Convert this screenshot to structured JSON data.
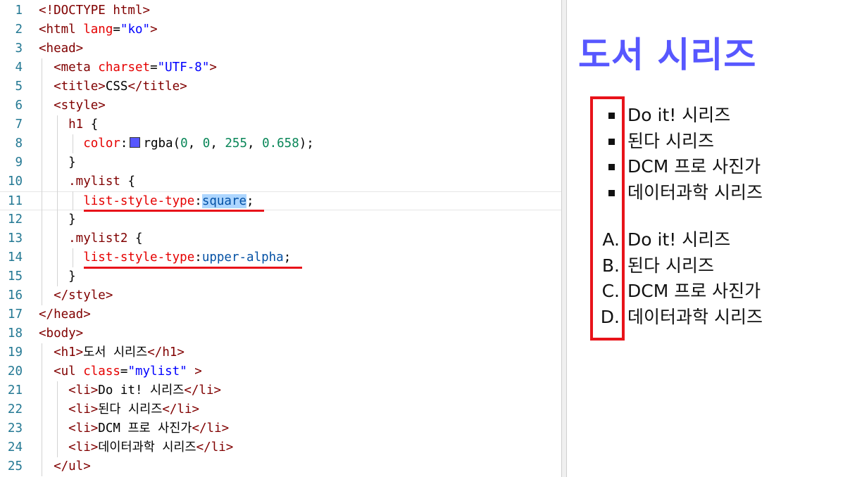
{
  "editor": {
    "lines": [
      {
        "n": "1",
        "parts": [
          {
            "t": "<!DOCTYPE html>",
            "c": "tag"
          }
        ]
      },
      {
        "n": "2",
        "parts": [
          {
            "t": "<html ",
            "c": "tag"
          },
          {
            "t": "lang",
            "c": "attr"
          },
          {
            "t": "=",
            "c": "txt"
          },
          {
            "t": "\"ko\"",
            "c": "val"
          },
          {
            "t": ">",
            "c": "tag"
          }
        ]
      },
      {
        "n": "3",
        "parts": [
          {
            "t": "<head>",
            "c": "tag"
          }
        ]
      },
      {
        "n": "4",
        "parts": [
          {
            "t": "  <meta ",
            "c": "tag"
          },
          {
            "t": "charset",
            "c": "attr"
          },
          {
            "t": "=",
            "c": "txt"
          },
          {
            "t": "\"UTF-8\"",
            "c": "val"
          },
          {
            "t": ">",
            "c": "tag"
          }
        ]
      },
      {
        "n": "5",
        "parts": [
          {
            "t": "  <title>",
            "c": "tag"
          },
          {
            "t": "CSS",
            "c": "txt"
          },
          {
            "t": "</title>",
            "c": "tag"
          }
        ]
      },
      {
        "n": "6",
        "parts": [
          {
            "t": "  <style>",
            "c": "tag"
          }
        ]
      },
      {
        "n": "7",
        "parts": [
          {
            "t": "    h1 ",
            "c": "sel"
          },
          {
            "t": "{",
            "c": "txt"
          }
        ]
      },
      {
        "n": "8",
        "parts": [
          {
            "t": "      color",
            "c": "prop"
          },
          {
            "t": ":",
            "c": "txt"
          },
          {
            "t": "",
            "c": "swatch"
          },
          {
            "t": "rgba(",
            "c": "txt"
          },
          {
            "t": "0",
            "c": "num"
          },
          {
            "t": ", ",
            "c": "txt"
          },
          {
            "t": "0",
            "c": "num"
          },
          {
            "t": ", ",
            "c": "txt"
          },
          {
            "t": "255",
            "c": "num"
          },
          {
            "t": ", ",
            "c": "txt"
          },
          {
            "t": "0.658",
            "c": "num"
          },
          {
            "t": ");",
            "c": "txt"
          }
        ]
      },
      {
        "n": "9",
        "parts": [
          {
            "t": "    }",
            "c": "txt"
          }
        ]
      },
      {
        "n": "10",
        "parts": [
          {
            "t": "    .mylist ",
            "c": "sel"
          },
          {
            "t": "{",
            "c": "txt"
          }
        ]
      },
      {
        "n": "11",
        "current": true,
        "parts": [
          {
            "t": "      list-style-type",
            "c": "prop"
          },
          {
            "t": ":",
            "c": "txt"
          },
          {
            "t": "square",
            "c": "pval hl"
          },
          {
            "t": ";",
            "c": "txt"
          }
        ]
      },
      {
        "n": "12",
        "parts": [
          {
            "t": "    }",
            "c": "txt"
          }
        ]
      },
      {
        "n": "13",
        "parts": [
          {
            "t": "    .mylist2 ",
            "c": "sel"
          },
          {
            "t": "{",
            "c": "txt"
          }
        ]
      },
      {
        "n": "14",
        "parts": [
          {
            "t": "      list-style-type",
            "c": "prop"
          },
          {
            "t": ":",
            "c": "txt"
          },
          {
            "t": "upper-alpha",
            "c": "pval"
          },
          {
            "t": ";",
            "c": "txt"
          }
        ]
      },
      {
        "n": "15",
        "parts": [
          {
            "t": "    }",
            "c": "txt"
          }
        ]
      },
      {
        "n": "16",
        "parts": [
          {
            "t": "  </style>",
            "c": "tag"
          }
        ]
      },
      {
        "n": "17",
        "parts": [
          {
            "t": "</head>",
            "c": "tag"
          }
        ]
      },
      {
        "n": "18",
        "parts": [
          {
            "t": "<body>",
            "c": "tag"
          }
        ]
      },
      {
        "n": "19",
        "parts": [
          {
            "t": "  <h1>",
            "c": "tag"
          },
          {
            "t": "도서 시리즈",
            "c": "txt"
          },
          {
            "t": "</h1>",
            "c": "tag"
          }
        ]
      },
      {
        "n": "20",
        "parts": [
          {
            "t": "  <ul ",
            "c": "tag"
          },
          {
            "t": "class",
            "c": "attr"
          },
          {
            "t": "=",
            "c": "txt"
          },
          {
            "t": "\"mylist\"",
            "c": "val"
          },
          {
            "t": " >",
            "c": "tag"
          }
        ]
      },
      {
        "n": "21",
        "parts": [
          {
            "t": "    <li>",
            "c": "tag"
          },
          {
            "t": "Do it! 시리즈",
            "c": "txt"
          },
          {
            "t": "</li>",
            "c": "tag"
          }
        ]
      },
      {
        "n": "22",
        "parts": [
          {
            "t": "    <li>",
            "c": "tag"
          },
          {
            "t": "된다 시리즈",
            "c": "txt"
          },
          {
            "t": "</li>",
            "c": "tag"
          }
        ]
      },
      {
        "n": "23",
        "parts": [
          {
            "t": "    <li>",
            "c": "tag"
          },
          {
            "t": "DCM 프로 사진가",
            "c": "txt"
          },
          {
            "t": "</li>",
            "c": "tag"
          }
        ]
      },
      {
        "n": "24",
        "parts": [
          {
            "t": "    <li>",
            "c": "tag"
          },
          {
            "t": "데이터과학 시리즈",
            "c": "txt"
          },
          {
            "t": "</li>",
            "c": "tag"
          }
        ]
      },
      {
        "n": "25",
        "parts": [
          {
            "t": "  </ul>",
            "c": "tag"
          }
        ]
      }
    ]
  },
  "preview": {
    "title": "도서 시리즈",
    "list1": [
      {
        "marker": "square",
        "text": "Do it! 시리즈"
      },
      {
        "marker": "square",
        "text": "된다 시리즈"
      },
      {
        "marker": "square",
        "text": "DCM 프로 사진가"
      },
      {
        "marker": "square",
        "text": "데이터과학 시리즈"
      }
    ],
    "list2": [
      {
        "marker": "A.",
        "text": "Do it! 시리즈"
      },
      {
        "marker": "B.",
        "text": "된다 시리즈"
      },
      {
        "marker": "C.",
        "text": "DCM 프로 사진가"
      },
      {
        "marker": "D.",
        "text": "데이터과학 시리즈"
      }
    ]
  },
  "colors": {
    "annotation": "#e8131a",
    "heading": "rgba(0, 0, 255, 0.658)"
  }
}
